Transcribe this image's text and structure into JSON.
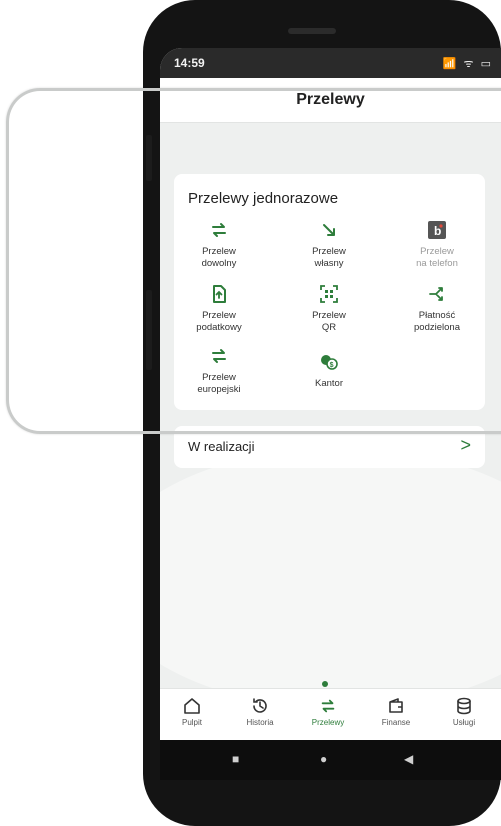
{
  "status": {
    "time": "14:59",
    "icons": "📶 ᯤ ▭"
  },
  "header": {
    "title": "Przelewy"
  },
  "card": {
    "title": "Przelewy jednorazowe",
    "tiles": [
      {
        "label": "Przelew\ndowolny",
        "icon": "transfer-arrows-icon"
      },
      {
        "label": "Przelew\nwłasny",
        "icon": "arrow-down-right-icon"
      },
      {
        "label": "Przelew\nna telefon",
        "icon": "blik-icon"
      },
      {
        "label": "Przelew\npodatkowy",
        "icon": "tax-document-icon"
      },
      {
        "label": "Przelew\nQR",
        "icon": "qr-code-icon"
      },
      {
        "label": "Płatność\npodzielona",
        "icon": "split-payment-icon"
      },
      {
        "label": "Przelew\neuropejski",
        "icon": "transfer-arrows-icon"
      },
      {
        "label": "Kantor",
        "icon": "currency-exchange-icon"
      }
    ]
  },
  "realizacja": {
    "label": "W realizacji",
    "arrow": ">"
  },
  "tabs": [
    {
      "label": "Pulpit",
      "icon": "home-icon"
    },
    {
      "label": "Historia",
      "icon": "history-icon"
    },
    {
      "label": "Przelewy",
      "icon": "transfer-arrows-icon"
    },
    {
      "label": "Finanse",
      "icon": "wallet-icon"
    },
    {
      "label": "Usługi",
      "icon": "database-icon"
    }
  ],
  "nav": {
    "square": "■",
    "circle": "●",
    "back": "◀"
  },
  "colors": {
    "accent": "#2e7d3b",
    "blik": "#555555"
  }
}
